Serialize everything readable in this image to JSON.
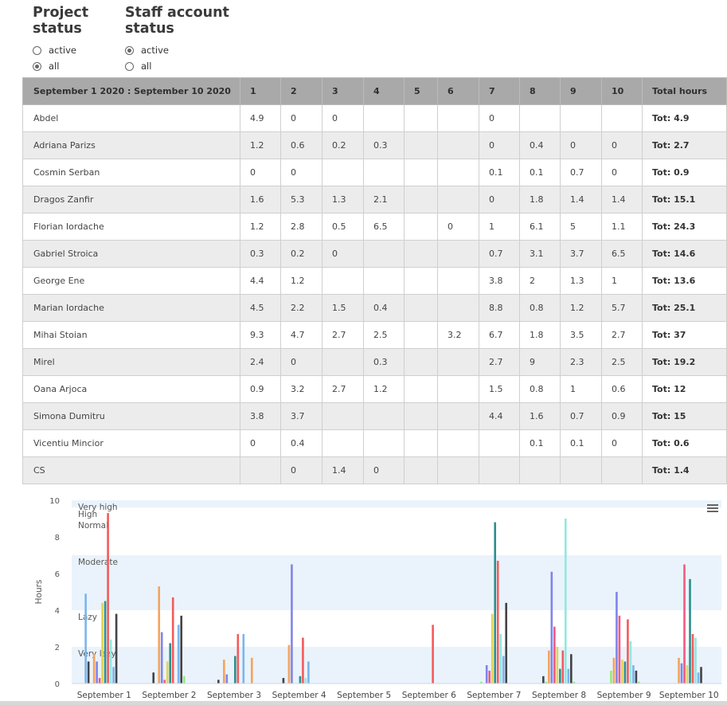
{
  "filters": {
    "project_status": {
      "title_line1": "Project",
      "title_line2": "status",
      "options": [
        {
          "label": "active",
          "checked": false
        },
        {
          "label": "all",
          "checked": true
        }
      ]
    },
    "staff_status": {
      "title_line1": "Staff account",
      "title_line2": "status",
      "options": [
        {
          "label": "active",
          "checked": true
        },
        {
          "label": "all",
          "checked": false
        }
      ]
    }
  },
  "table": {
    "headers": [
      "September 1 2020 : September 10 2020",
      "1",
      "2",
      "3",
      "4",
      "5",
      "6",
      "7",
      "8",
      "9",
      "10",
      "Total hours"
    ],
    "rows": [
      {
        "name": "Abdel",
        "values": [
          "4.9",
          "0",
          "0",
          "",
          "",
          "",
          "0",
          "",
          "",
          ""
        ],
        "total": "Tot: 4.9"
      },
      {
        "name": "Adriana Parizs",
        "values": [
          "1.2",
          "0.6",
          "0.2",
          "0.3",
          "",
          "",
          "0",
          "0.4",
          "0",
          "0"
        ],
        "total": "Tot: 2.7"
      },
      {
        "name": "Cosmin Serban",
        "values": [
          "0",
          "0",
          "",
          "",
          "",
          "",
          "0.1",
          "0.1",
          "0.7",
          "0"
        ],
        "total": "Tot: 0.9"
      },
      {
        "name": "Dragos Zanfir",
        "values": [
          "1.6",
          "5.3",
          "1.3",
          "2.1",
          "",
          "",
          "0",
          "1.8",
          "1.4",
          "1.4"
        ],
        "total": "Tot: 15.1"
      },
      {
        "name": "Florian Iordache",
        "values": [
          "1.2",
          "2.8",
          "0.5",
          "6.5",
          "",
          "0",
          "1",
          "6.1",
          "5",
          "1.1"
        ],
        "total": "Tot: 24.3"
      },
      {
        "name": "Gabriel Stroica",
        "values": [
          "0.3",
          "0.2",
          "0",
          "",
          "",
          "",
          "0.7",
          "3.1",
          "3.7",
          "6.5"
        ],
        "total": "Tot: 14.6"
      },
      {
        "name": "George Ene",
        "values": [
          "4.4",
          "1.2",
          "",
          "",
          "",
          "",
          "3.8",
          "2",
          "1.3",
          "1"
        ],
        "total": "Tot: 13.6"
      },
      {
        "name": "Marian Iordache",
        "values": [
          "4.5",
          "2.2",
          "1.5",
          "0.4",
          "",
          "",
          "8.8",
          "0.8",
          "1.2",
          "5.7"
        ],
        "total": "Tot: 25.1"
      },
      {
        "name": "Mihai Stoian",
        "values": [
          "9.3",
          "4.7",
          "2.7",
          "2.5",
          "",
          "3.2",
          "6.7",
          "1.8",
          "3.5",
          "2.7"
        ],
        "total": "Tot: 37"
      },
      {
        "name": "Mirel",
        "values": [
          "2.4",
          "0",
          "",
          "0.3",
          "",
          "",
          "2.7",
          "9",
          "2.3",
          "2.5"
        ],
        "total": "Tot: 19.2"
      },
      {
        "name": "Oana Arjoca",
        "values": [
          "0.9",
          "3.2",
          "2.7",
          "1.2",
          "",
          "",
          "1.5",
          "0.8",
          "1",
          "0.6"
        ],
        "total": "Tot: 12"
      },
      {
        "name": "Simona Dumitru",
        "values": [
          "3.8",
          "3.7",
          "",
          "",
          "",
          "",
          "4.4",
          "1.6",
          "0.7",
          "0.9"
        ],
        "total": "Tot: 15"
      },
      {
        "name": "Vicentiu Mincior",
        "values": [
          "0",
          "0.4",
          "",
          "",
          "",
          "",
          "",
          "0.1",
          "0.1",
          "0"
        ],
        "total": "Tot: 0.6"
      },
      {
        "name": "CS",
        "values": [
          "",
          "0",
          "1.4",
          "0",
          "",
          "",
          "",
          "",
          "",
          ""
        ],
        "total": "Tot: 1.4"
      }
    ]
  },
  "chart_data": {
    "type": "bar",
    "ylabel": "Hours",
    "ylim": [
      0,
      10
    ],
    "yticks": [
      "0",
      "2",
      "4",
      "6",
      "8",
      "10"
    ],
    "grid": false,
    "legend": "none",
    "menu_icon": "hamburger-icon",
    "bands": [
      {
        "label": "Very high",
        "from": 9.6,
        "to": 10
      },
      {
        "label": "High",
        "from": 9,
        "to": 9.6
      },
      {
        "label": "Normal",
        "from": 7,
        "to": 9
      },
      {
        "label": "Moderate",
        "from": 4,
        "to": 7
      },
      {
        "label": "Lazy",
        "from": 2,
        "to": 4
      },
      {
        "label": "Very lazy",
        "from": 0,
        "to": 2
      }
    ],
    "categories": [
      "September 1",
      "September 2",
      "September 3",
      "September 4",
      "September 5",
      "September 6",
      "September 7",
      "September 8",
      "September 9",
      "September 10"
    ],
    "series": [
      {
        "color": "#7cb5ec",
        "values": [
          4.9,
          0,
          0,
          null,
          null,
          null,
          0,
          null,
          null,
          null
        ]
      },
      {
        "color": "#434348",
        "values": [
          1.2,
          0.6,
          0.2,
          0.3,
          null,
          null,
          0,
          0.4,
          0,
          0
        ]
      },
      {
        "color": "#90ed7d",
        "values": [
          0,
          0,
          null,
          null,
          null,
          null,
          0.1,
          0.1,
          0.7,
          0
        ]
      },
      {
        "color": "#f7a35c",
        "values": [
          1.6,
          5.3,
          1.3,
          2.1,
          null,
          null,
          0,
          1.8,
          1.4,
          1.4
        ]
      },
      {
        "color": "#8085e9",
        "values": [
          1.2,
          2.8,
          0.5,
          6.5,
          null,
          0,
          1,
          6.1,
          5,
          1.1
        ]
      },
      {
        "color": "#f15c80",
        "values": [
          0.3,
          0.2,
          0,
          null,
          null,
          null,
          0.7,
          3.1,
          3.7,
          6.5
        ]
      },
      {
        "color": "#e4d354",
        "values": [
          4.4,
          1.2,
          null,
          null,
          null,
          null,
          3.8,
          2,
          1.3,
          1
        ]
      },
      {
        "color": "#2b908f",
        "values": [
          4.5,
          2.2,
          1.5,
          0.4,
          null,
          null,
          8.8,
          0.8,
          1.2,
          5.7
        ]
      },
      {
        "color": "#f45b5b",
        "values": [
          9.3,
          4.7,
          2.7,
          2.5,
          null,
          3.2,
          6.7,
          1.8,
          3.5,
          2.7
        ]
      },
      {
        "color": "#91e8e1",
        "values": [
          2.4,
          0,
          null,
          0.3,
          null,
          null,
          2.7,
          9,
          2.3,
          2.5
        ]
      },
      {
        "color": "#7cb5ec",
        "values": [
          0.9,
          3.2,
          2.7,
          1.2,
          null,
          null,
          1.5,
          0.8,
          1,
          0.6
        ]
      },
      {
        "color": "#434348",
        "values": [
          3.8,
          3.7,
          null,
          null,
          null,
          null,
          4.4,
          1.6,
          0.7,
          0.9
        ]
      },
      {
        "color": "#90ed7d",
        "values": [
          0,
          0.4,
          null,
          null,
          null,
          null,
          null,
          0.1,
          0.1,
          0
        ]
      },
      {
        "color": "#f7a35c",
        "values": [
          null,
          0,
          1.4,
          0,
          null,
          null,
          null,
          null,
          null,
          null
        ]
      }
    ]
  }
}
